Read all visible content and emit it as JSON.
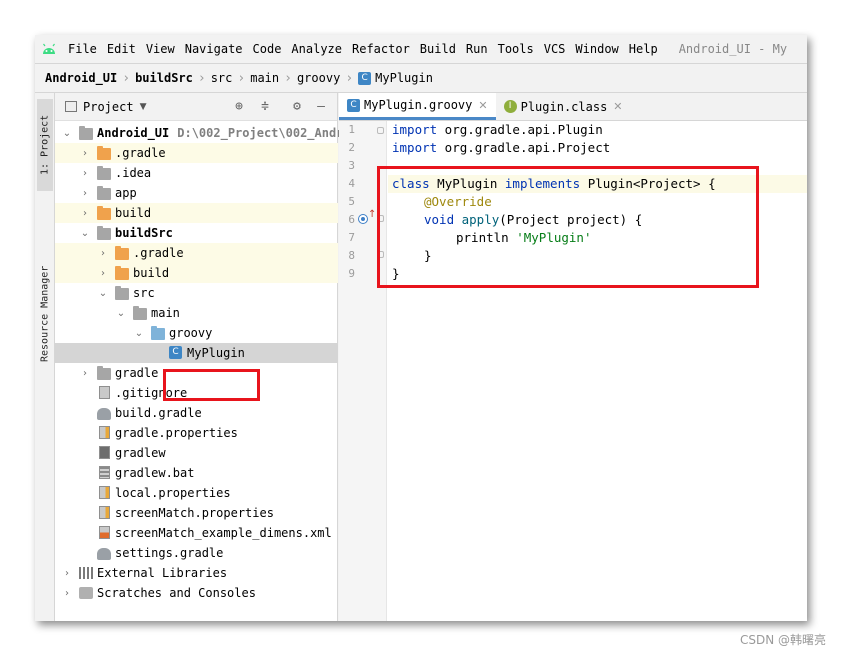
{
  "menu": {
    "items": [
      "File",
      "Edit",
      "View",
      "Navigate",
      "Code",
      "Analyze",
      "Refactor",
      "Build",
      "Run",
      "Tools",
      "VCS",
      "Window",
      "Help"
    ],
    "window_title": "Android_UI - My"
  },
  "breadcrumb": {
    "items": [
      "Android_UI",
      "buildSrc",
      "src",
      "main",
      "groovy",
      "MyPlugin"
    ]
  },
  "sidebar": {
    "project_tab": "1: Project",
    "resource_tab": "Resource Manager"
  },
  "project_panel": {
    "title": "Project",
    "tree": [
      {
        "label": "Android_UI",
        "extra": "D:\\002_Project\\002_Andr"
      },
      {
        "label": ".gradle"
      },
      {
        "label": ".idea"
      },
      {
        "label": "app"
      },
      {
        "label": "build"
      },
      {
        "label": "buildSrc"
      },
      {
        "label": ".gradle"
      },
      {
        "label": "build"
      },
      {
        "label": "src"
      },
      {
        "label": "main"
      },
      {
        "label": "groovy"
      },
      {
        "label": "MyPlugin"
      },
      {
        "label": "gradle"
      },
      {
        "label": ".gitignore"
      },
      {
        "label": "build.gradle"
      },
      {
        "label": "gradle.properties"
      },
      {
        "label": "gradlew"
      },
      {
        "label": "gradlew.bat"
      },
      {
        "label": "local.properties"
      },
      {
        "label": "screenMatch.properties"
      },
      {
        "label": "screenMatch_example_dimens.xml"
      },
      {
        "label": "settings.gradle"
      },
      {
        "label": "External Libraries"
      },
      {
        "label": "Scratches and Consoles"
      }
    ]
  },
  "editor": {
    "tabs": [
      {
        "label": "MyPlugin.groovy",
        "icon": "C"
      },
      {
        "label": "Plugin.class",
        "icon": "I"
      }
    ],
    "line_numbers": [
      "1",
      "2",
      "3",
      "4",
      "5",
      "6",
      "7",
      "8",
      "9"
    ],
    "code": {
      "l1_kw": "import",
      "l1_rest": " org.gradle.api.Plugin",
      "l2_kw": "import",
      "l2_rest": " org.gradle.api.Project",
      "l4_kw1": "class",
      "l4_name": " MyPlugin ",
      "l4_kw2": "implements",
      "l4_rest": " Plugin<Project> {",
      "l5_ann": "@Override",
      "l6_kw": "void",
      "l6_fn": " apply",
      "l6_rest": "(Project project) {",
      "l7_fn": "println ",
      "l7_str": "'MyPlugin'",
      "l8": "}",
      "l9": "}"
    }
  },
  "watermark": "CSDN @韩曙亮"
}
